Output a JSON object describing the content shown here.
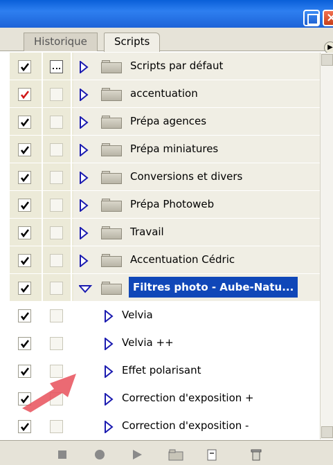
{
  "tabs": [
    {
      "label": "Historique",
      "active": false
    },
    {
      "label": "Scripts",
      "active": true
    }
  ],
  "colors": {
    "title_bar": "#2e7ff0",
    "selection": "#1047b8",
    "row_bg": "#ecead8",
    "arrow_overlay": "#e8505a",
    "expand_arrow": "#1b1bb0"
  },
  "rows": [
    {
      "label": "Scripts par défaut",
      "type": "folder",
      "checked": true,
      "check_color": "black",
      "dialog": true,
      "expanded": false
    },
    {
      "label": "accentuation",
      "type": "folder",
      "checked": true,
      "check_color": "red",
      "dialog": false,
      "expanded": false
    },
    {
      "label": "Prépa agences",
      "type": "folder",
      "checked": true,
      "check_color": "black",
      "dialog": false,
      "expanded": false
    },
    {
      "label": "Prépa miniatures",
      "type": "folder",
      "checked": true,
      "check_color": "black",
      "dialog": false,
      "expanded": false
    },
    {
      "label": "Conversions et divers",
      "type": "folder",
      "checked": true,
      "check_color": "black",
      "dialog": false,
      "expanded": false
    },
    {
      "label": "Prépa Photoweb",
      "type": "folder",
      "checked": true,
      "check_color": "black",
      "dialog": false,
      "expanded": false
    },
    {
      "label": "Travail",
      "type": "folder",
      "checked": true,
      "check_color": "black",
      "dialog": false,
      "expanded": false
    },
    {
      "label": "Accentuation Cédric",
      "type": "folder",
      "checked": true,
      "check_color": "black",
      "dialog": false,
      "expanded": false
    },
    {
      "label": "Filtres photo - Aube-Natu...",
      "type": "folder",
      "checked": true,
      "check_color": "black",
      "dialog": false,
      "expanded": true,
      "selected": true
    },
    {
      "label": "Velvia",
      "type": "action",
      "checked": true,
      "check_color": "black",
      "dialog": false
    },
    {
      "label": "Velvia ++",
      "type": "action",
      "checked": true,
      "check_color": "black",
      "dialog": false
    },
    {
      "label": "Effet polarisant",
      "type": "action",
      "checked": true,
      "check_color": "black",
      "dialog": false
    },
    {
      "label": "Correction d'exposition +",
      "type": "action",
      "checked": true,
      "check_color": "black",
      "dialog": false
    },
    {
      "label": "Correction d'exposition -",
      "type": "action",
      "checked": true,
      "check_color": "black",
      "dialog": false
    }
  ],
  "toolbar": [
    {
      "icon": "stop-icon"
    },
    {
      "icon": "record-icon"
    },
    {
      "icon": "play-icon"
    },
    {
      "icon": "new-folder-icon"
    },
    {
      "icon": "new-script-icon"
    },
    {
      "icon": "trash-icon"
    }
  ]
}
